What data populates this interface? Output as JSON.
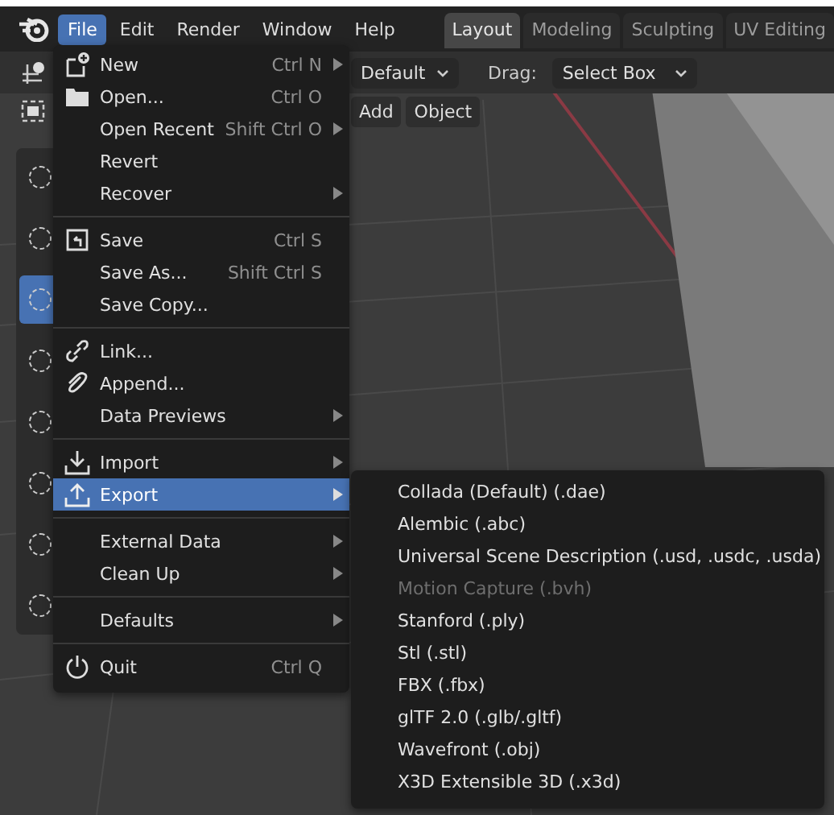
{
  "menubar": {
    "items": [
      {
        "label": "File",
        "selected": true
      },
      {
        "label": "Edit",
        "selected": false
      },
      {
        "label": "Render",
        "selected": false
      },
      {
        "label": "Window",
        "selected": false
      },
      {
        "label": "Help",
        "selected": false
      }
    ]
  },
  "workspace_tabs": [
    {
      "label": "Layout",
      "selected": true
    },
    {
      "label": "Modeling",
      "selected": false
    },
    {
      "label": "Sculpting",
      "selected": false
    },
    {
      "label": "UV Editing",
      "selected": false
    }
  ],
  "header": {
    "orientation_value": "Default",
    "drag_label": "Drag:",
    "drag_value": "Select Box"
  },
  "header_buttons": [
    "Add",
    "Object"
  ],
  "toolbar": [
    {
      "selected": false
    },
    {
      "selected": false
    },
    {
      "selected": true
    },
    {
      "selected": false
    },
    {
      "selected": false
    },
    {
      "selected": false
    },
    {
      "selected": false
    },
    {
      "selected": false
    }
  ],
  "file_menu": {
    "items": [
      {
        "kind": "item",
        "label": "New",
        "shortcut": "Ctrl N",
        "submenu": true,
        "selected": false
      },
      {
        "kind": "item",
        "label": "Open...",
        "shortcut": "Ctrl O",
        "submenu": false,
        "selected": false
      },
      {
        "kind": "item",
        "label": "Open Recent",
        "shortcut": "Shift Ctrl O",
        "submenu": true,
        "selected": false
      },
      {
        "kind": "item",
        "label": "Revert",
        "submenu": false,
        "selected": false
      },
      {
        "kind": "item",
        "label": "Recover",
        "submenu": true,
        "selected": false
      },
      {
        "kind": "separator"
      },
      {
        "kind": "item",
        "label": "Save",
        "shortcut": "Ctrl S",
        "submenu": false,
        "selected": false
      },
      {
        "kind": "item",
        "label": "Save As...",
        "shortcut": "Shift Ctrl S",
        "submenu": false,
        "selected": false
      },
      {
        "kind": "item",
        "label": "Save Copy...",
        "submenu": false,
        "selected": false
      },
      {
        "kind": "separator"
      },
      {
        "kind": "item",
        "label": "Link...",
        "submenu": false,
        "selected": false
      },
      {
        "kind": "item",
        "label": "Append...",
        "submenu": false,
        "selected": false
      },
      {
        "kind": "item",
        "label": "Data Previews",
        "submenu": true,
        "selected": false
      },
      {
        "kind": "separator"
      },
      {
        "kind": "item",
        "label": "Import",
        "submenu": true,
        "selected": false
      },
      {
        "kind": "item",
        "label": "Export",
        "submenu": true,
        "selected": true
      },
      {
        "kind": "separator"
      },
      {
        "kind": "item",
        "label": "External Data",
        "submenu": true,
        "selected": false
      },
      {
        "kind": "item",
        "label": "Clean Up",
        "submenu": true,
        "selected": false
      },
      {
        "kind": "separator"
      },
      {
        "kind": "item",
        "label": "Defaults",
        "submenu": true,
        "selected": false
      },
      {
        "kind": "separator"
      },
      {
        "kind": "item",
        "label": "Quit",
        "shortcut": "Ctrl Q",
        "submenu": false,
        "selected": false
      }
    ]
  },
  "export_menu": {
    "items": [
      {
        "label": "Collada (Default) (.dae)",
        "disabled": false
      },
      {
        "label": "Alembic (.abc)",
        "disabled": false
      },
      {
        "label": "Universal Scene Description (.usd, .usdc, .usda)",
        "disabled": false
      },
      {
        "label": "Motion Capture (.bvh)",
        "disabled": true
      },
      {
        "label": "Stanford (.ply)",
        "disabled": false
      },
      {
        "label": "Stl (.stl)",
        "disabled": false
      },
      {
        "label": "FBX (.fbx)",
        "disabled": false
      },
      {
        "label": "glTF 2.0 (.glb/.gltf)",
        "disabled": false
      },
      {
        "label": "Wavefront (.obj)",
        "disabled": false
      },
      {
        "label": "X3D Extensible 3D (.x3d)",
        "disabled": false
      }
    ]
  }
}
